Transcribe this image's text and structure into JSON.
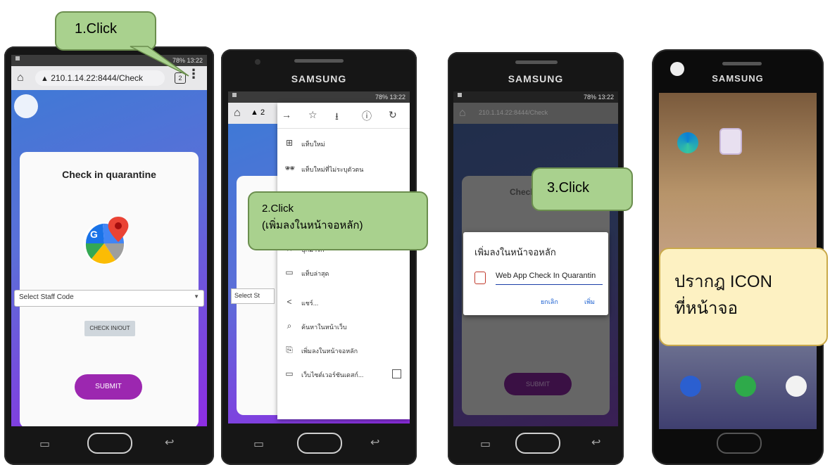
{
  "callouts": {
    "step1": "1.Click",
    "step2_line1": "2.Click",
    "step2_line2": "(เพิ่มลงในหน้าจอหลัก)",
    "step3": "3.Click",
    "step4_line1": "ปรากฎ ICON",
    "step4_line2": "ที่หน้าจอ"
  },
  "phone1": {
    "status": "78% 13:22",
    "url": "210.1.14.22:8444/Check",
    "tab_count": "2",
    "card_title": "Check in quarantine",
    "select_placeholder": "Select Staff Code",
    "checkin_button": "CHECK IN/OUT",
    "submit_button": "SUBMIT"
  },
  "phone2": {
    "brand": "SAMSUNG",
    "status": "78% 13:22",
    "url_partial": "2",
    "select_partial": "Select St",
    "menu_items": [
      "แท็บใหม่",
      "แท็บใหม่ที่ไม่ระบุตัวตน",
      "บุ๊กมาร์ก",
      "แท็บล่าสุด",
      "แชร์...",
      "ค้นหาในหน้าเว็บ",
      "เพิ่มลงในหน้าจอหลัก",
      "เว็บไซต์เวอร์ชันเดสก์..."
    ]
  },
  "phone3": {
    "brand": "SAMSUNG",
    "status": "78% 13:22",
    "url": "210.1.14.22:8444/Check",
    "card_title_partial": "Check",
    "dialog_title": "เพิ่มลงในหน้าจอหลัก",
    "dialog_input": "Web App Check In Quarantin",
    "cancel_label": "ยกเลิก",
    "add_label": "เพิ่ม",
    "submit_button": "SUBMIT"
  },
  "phone4": {
    "brand": "SAMSUNG"
  },
  "colors": {
    "callout_green": "#a9d18e",
    "callout_yellow": "#fdf1c2",
    "submit_purple": "#9c27b0",
    "bg_gradient_blue": "#3a7bd5",
    "bg_gradient_purple": "#8e2de2"
  }
}
